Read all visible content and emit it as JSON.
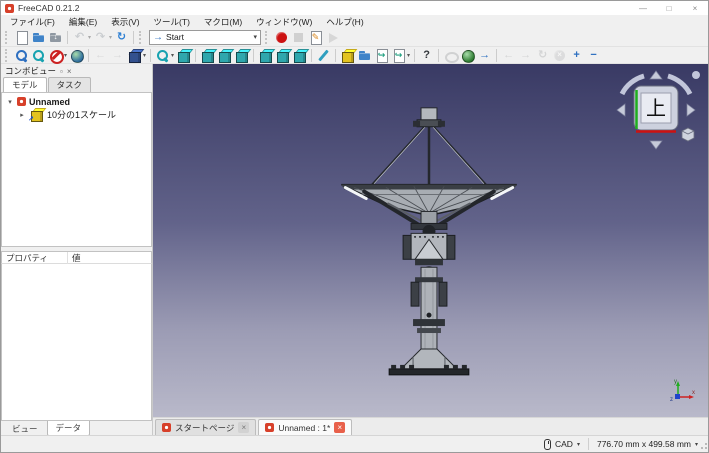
{
  "window": {
    "title": "FreeCAD 0.21.2",
    "controls": {
      "minimize": "—",
      "maximize": "□",
      "close": "×"
    }
  },
  "menubar": {
    "items": [
      {
        "name": "menu-file",
        "label": "ファイル(F)"
      },
      {
        "name": "menu-edit",
        "label": "編集(E)"
      },
      {
        "name": "menu-view",
        "label": "表示(V)"
      },
      {
        "name": "menu-tools",
        "label": "ツール(T)"
      },
      {
        "name": "menu-macro",
        "label": "マクロ(M)"
      },
      {
        "name": "menu-windows",
        "label": "ウィンドウ(W)"
      },
      {
        "name": "menu-help",
        "label": "ヘルプ(H)"
      }
    ]
  },
  "toolbars": {
    "row1_left": [
      {
        "name": "new-document-icon",
        "kind": "page",
        "color": "#ffffff"
      },
      {
        "name": "open-document-icon",
        "kind": "folder",
        "color": "#3f83c8"
      },
      {
        "name": "save-document-icon",
        "kind": "folder",
        "color": "#8f98a2",
        "glyph": "↓",
        "glyph_color": "#ffffff"
      },
      {
        "kind": "sep"
      },
      {
        "name": "undo-icon",
        "kind": "glyph",
        "color": "#8fa6bf",
        "glyph": "↶",
        "dropdown": true,
        "disabled": true
      },
      {
        "name": "redo-icon",
        "kind": "glyph",
        "color": "#8fa6bf",
        "glyph": "↷",
        "dropdown": true,
        "disabled": true
      },
      {
        "name": "refresh-icon",
        "kind": "glyph",
        "color": "#2d7fd3",
        "glyph": "↻"
      },
      {
        "kind": "sep"
      }
    ],
    "workbench_selector": {
      "value": "Start",
      "icon_glyph": "→",
      "dropdown_glyph": "▾"
    },
    "row1_right": [
      {
        "name": "macro-record-icon",
        "kind": "circle",
        "color": "#cc1111"
      },
      {
        "name": "macro-stop-icon",
        "kind": "square",
        "color": "#a9abad",
        "disabled": true
      },
      {
        "name": "macro-edit-icon",
        "kind": "page",
        "color": "#ffffff",
        "glyph": "✎",
        "glyph_color": "#d8871f"
      },
      {
        "name": "macro-play-icon",
        "kind": "tri",
        "color": "#b9bbbd",
        "disabled": true
      }
    ],
    "row2": [
      {
        "name": "view-fit-all-icon",
        "kind": "magnifier",
        "color": "#2d6fc0"
      },
      {
        "name": "view-fit-selection-icon",
        "kind": "magnifier",
        "color": "#17a2b0"
      },
      {
        "name": "draw-style-icon",
        "kind": "noentry",
        "color": "#cc2222",
        "dropdown": true
      },
      {
        "name": "sync-view-icon",
        "kind": "globe",
        "color": "#2f6f9f"
      },
      {
        "kind": "sep"
      },
      {
        "name": "nav-back-icon",
        "kind": "glyph",
        "color": "#b9bdc2",
        "glyph": "←",
        "disabled": true
      },
      {
        "name": "nav-forward-icon",
        "kind": "glyph",
        "color": "#b9bdc2",
        "glyph": "→",
        "disabled": true
      },
      {
        "name": "go-to-linked-object-icon",
        "kind": "cube3d",
        "color": "#33518f",
        "dropdown": true
      },
      {
        "kind": "sep"
      },
      {
        "name": "zoom-icon",
        "kind": "magnifier",
        "color": "#17a2b0",
        "dropdown": true
      },
      {
        "name": "view-axonometric-icon",
        "kind": "cube3d",
        "color": "#2fa7ad"
      },
      {
        "kind": "sep"
      },
      {
        "name": "view-front-icon",
        "kind": "cube3d",
        "color": "#2fa7ad"
      },
      {
        "name": "view-top-icon",
        "kind": "cube3d",
        "color": "#2fa7ad"
      },
      {
        "name": "view-right-icon",
        "kind": "cube3d",
        "color": "#2fa7ad"
      },
      {
        "kind": "sep"
      },
      {
        "name": "view-rear-icon",
        "kind": "cube3d",
        "color": "#2fa7ad"
      },
      {
        "name": "view-bottom-icon",
        "kind": "cube3d",
        "color": "#2fa7ad"
      },
      {
        "name": "view-left-icon",
        "kind": "cube3d",
        "color": "#2fa7ad"
      },
      {
        "kind": "sep"
      },
      {
        "name": "measure-distance-icon",
        "kind": "slash",
        "color": "#2f9fbf"
      },
      {
        "kind": "sep"
      },
      {
        "name": "create-part-icon",
        "kind": "cube3d",
        "color": "#e3c31f"
      },
      {
        "name": "create-group-icon",
        "kind": "folder",
        "color": "#3f83c8"
      },
      {
        "name": "make-link-icon",
        "kind": "page",
        "color": "#ffffff",
        "glyph": "↪",
        "glyph_color": "#1f9f7f"
      },
      {
        "name": "make-sub-link-icon",
        "kind": "page",
        "color": "#ffffff",
        "glyph": "↪",
        "glyph_color": "#1f9f7f",
        "dropdown": true
      },
      {
        "kind": "sep"
      },
      {
        "name": "whats-this-icon",
        "kind": "glyph",
        "color": "#33373c",
        "glyph": "?"
      },
      {
        "kind": "sep"
      },
      {
        "name": "web-stop-load-icon",
        "kind": "circle-o",
        "color": "#a9adb2",
        "disabled": true
      },
      {
        "name": "web-home-icon",
        "kind": "globe",
        "color": "#2e7d32"
      },
      {
        "name": "web-open-url-icon",
        "kind": "glyph",
        "color": "#2d6fc0",
        "glyph": "→"
      },
      {
        "kind": "sep"
      },
      {
        "name": "browser-back-icon",
        "kind": "glyph",
        "color": "#b0b4b9",
        "glyph": "←",
        "disabled": true
      },
      {
        "name": "browser-forward-icon",
        "kind": "glyph",
        "color": "#b0b4b9",
        "glyph": "→",
        "disabled": true
      },
      {
        "name": "browser-refresh-icon",
        "kind": "glyph",
        "color": "#b0b4b9",
        "glyph": "↻",
        "disabled": true
      },
      {
        "name": "browser-stop-icon",
        "kind": "circle",
        "color": "#c3c6ca",
        "glyph": "×",
        "glyph_color": "#ffffff",
        "disabled": true
      },
      {
        "name": "browser-zoom-in-icon",
        "kind": "glyph",
        "color": "#2d6fc0",
        "glyph": "+"
      },
      {
        "name": "browser-zoom-out-icon",
        "kind": "glyph",
        "color": "#2d6fc0",
        "glyph": "−"
      }
    ]
  },
  "combo_view": {
    "title": "コンボビュー",
    "float_glyph": "▫",
    "close_glyph": "×",
    "tab_model": "モデル",
    "tab_task": "タスク",
    "tree": {
      "root_expander": "▾",
      "root_label": "Unnamed",
      "child_expander": "▸",
      "child_label": "10分の1スケール"
    },
    "properties_header": {
      "col1": "プロパティ",
      "col2": "値"
    },
    "bottom_tab_view": "ビュー",
    "bottom_tab_data": "データ"
  },
  "viewport": {
    "bg_top_color": "#393a64",
    "bg_bottom_color": "#b9b9ca",
    "nav_cube_top_label": "上",
    "axis_x_label": "x",
    "axis_y_label": "y",
    "axis_z_label": "z"
  },
  "mdi_tabs": {
    "start_page_label": "スタートページ",
    "start_page_close": "×",
    "document_label": "Unnamed : 1*",
    "document_close": "×"
  },
  "status_bar": {
    "nav_style_label": "CAD",
    "nav_style_dropdown": "▾",
    "dimensions": "776.70 mm x 499.58 mm",
    "dimensions_dropdown": "▾"
  }
}
